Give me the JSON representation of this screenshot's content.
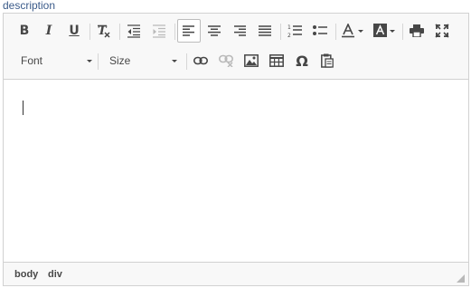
{
  "field": {
    "label": "description"
  },
  "toolbar": {
    "bold_label": "B",
    "italic_label": "I",
    "underline_label": "U",
    "font_combo": {
      "value": "Font"
    },
    "size_combo": {
      "value": "Size"
    },
    "special_char_label": "Ω",
    "icons": [
      "bold-icon",
      "italic-icon",
      "underline-icon",
      "remove-format-icon",
      "decrease-indent-icon",
      "increase-indent-icon",
      "align-left-icon",
      "align-center-icon",
      "align-right-icon",
      "justify-icon",
      "numbered-list-icon",
      "bulleted-list-icon",
      "text-color-icon",
      "background-color-icon",
      "print-icon",
      "maximize-icon",
      "link-icon",
      "unlink-icon",
      "image-icon",
      "table-icon",
      "special-character-icon",
      "paste-from-word-icon"
    ],
    "states": {
      "align_left": "active",
      "increase_indent": "disabled",
      "unlink": "disabled"
    }
  },
  "statusbar": {
    "path": [
      "body",
      "div"
    ]
  },
  "colors": {
    "toolbar_bg": "#f8f8f8",
    "border": "#d1d1d1",
    "label": "#3b5b8a",
    "icon": "#474747"
  }
}
